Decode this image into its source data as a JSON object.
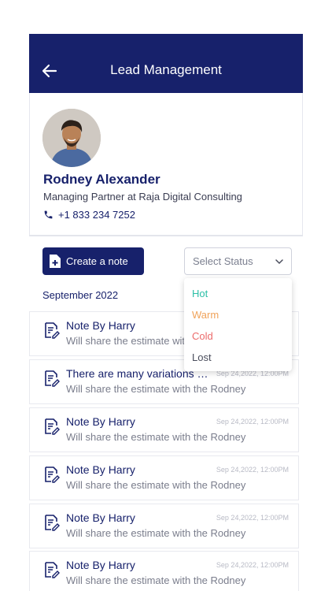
{
  "header": {
    "title": "Lead Management"
  },
  "profile": {
    "name": "Rodney Alexander",
    "role": "Managing Partner at Raja Digital Consulting",
    "phone": "+1 833 234 7252"
  },
  "actions": {
    "create_note_label": "Create a note",
    "status_placeholder": "Select Status"
  },
  "status_options": [
    {
      "label": "Hot",
      "color": "#2bbfa6"
    },
    {
      "label": "Warm",
      "color": "#f0a35a"
    },
    {
      "label": "Cold",
      "color": "#ec6b6b"
    },
    {
      "label": "Lost",
      "color": "#4a4d5c"
    }
  ],
  "month_label": "September 2022",
  "notes": [
    {
      "title": "Note By Harry",
      "subtitle": "Will share the estimate with the Rodney",
      "time": ""
    },
    {
      "title": "There are many variations of passages",
      "subtitle": "Will share the estimate with the Rodney",
      "time": "Sep 24,2022, 12:00PM"
    },
    {
      "title": "Note By Harry",
      "subtitle": "Will share the estimate with the Rodney",
      "time": "Sep 24,2022, 12:00PM"
    },
    {
      "title": "Note By Harry",
      "subtitle": "Will share the estimate with the Rodney",
      "time": "Sep 24,2022, 12:00PM"
    },
    {
      "title": "Note By Harry",
      "subtitle": "Will share the estimate with the Rodney",
      "time": "Sep 24,2022, 12:00PM"
    },
    {
      "title": "Note By Harry",
      "subtitle": "Will share the estimate with the Rodney",
      "time": "Sep 24,2022, 12:00PM"
    }
  ]
}
